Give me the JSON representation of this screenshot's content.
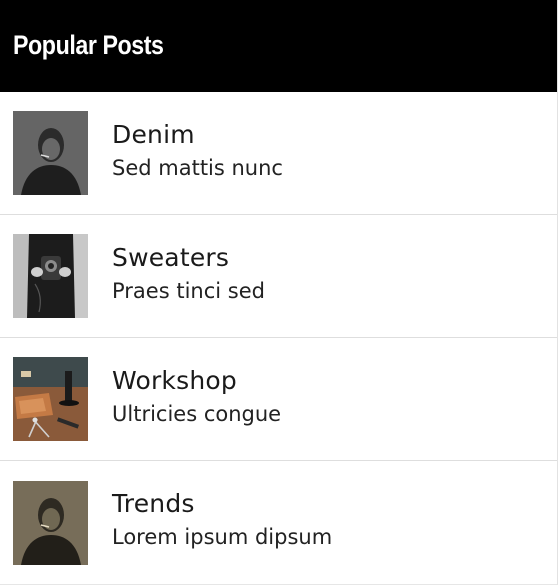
{
  "widget": {
    "title": "Popular Posts"
  },
  "posts": [
    {
      "title": "Denim",
      "subtitle": "Sed mattis nunc",
      "thumbnail": "portrait-man-smoking-bw"
    },
    {
      "title": "Sweaters",
      "subtitle": "Praes tinci sed",
      "thumbnail": "person-holding-camera-bw"
    },
    {
      "title": "Workshop",
      "subtitle": "Ultricies congue",
      "thumbnail": "workbench-leather-tools"
    },
    {
      "title": "Trends",
      "subtitle": "Lorem ipsum dipsum",
      "thumbnail": "portrait-man-smoking-sepia"
    }
  ],
  "colors": {
    "header_bg": "#000000",
    "header_text": "#ffffff",
    "divider": "#dedede"
  }
}
